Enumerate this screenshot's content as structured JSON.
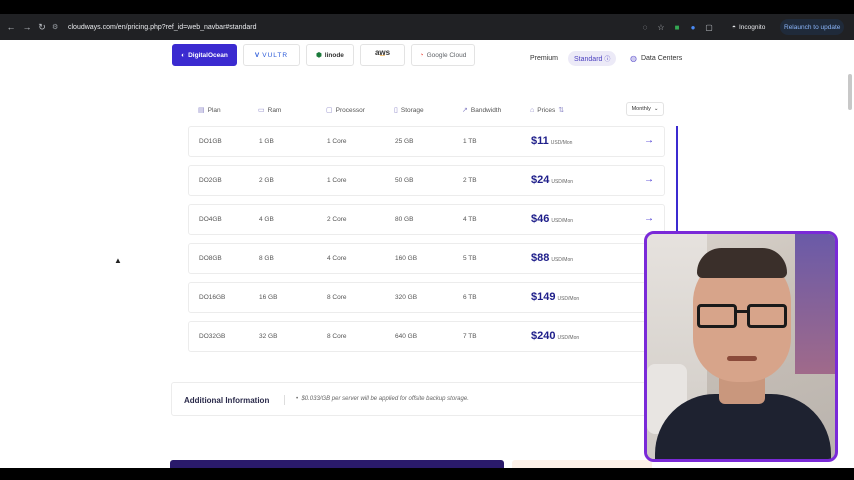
{
  "browser": {
    "url": "cloudways.com/en/pricing.php?ref_id=web_navbar#standard",
    "incognito_label": "Incognito",
    "relaunch_label": "Relaunch to update"
  },
  "providers": [
    {
      "label": "DigitalOcean",
      "logo": "◐",
      "active": true
    },
    {
      "label": "VULTR",
      "logo": "V",
      "active": false
    },
    {
      "label": "linode",
      "logo": "⬢",
      "active": false
    },
    {
      "label": "aws",
      "logo": "",
      "active": false
    },
    {
      "label": "Google Cloud",
      "logo": "◔",
      "active": false
    }
  ],
  "plan_toggle": {
    "premium": "Premium",
    "standard": "Standard"
  },
  "data_centers_label": "Data Centers",
  "table": {
    "headers": {
      "plan": "Plan",
      "ram": "Ram",
      "processor": "Processor",
      "storage": "Storage",
      "bandwidth": "Bandwidth",
      "prices": "Prices"
    },
    "billing_select": "Monthly",
    "price_unit": "USD/Mon",
    "rows": [
      {
        "plan": "DO1GB",
        "ram": "1 GB",
        "processor": "1 Core",
        "storage": "25 GB",
        "bandwidth": "1 TB",
        "price": "$11"
      },
      {
        "plan": "DO2GB",
        "ram": "2 GB",
        "processor": "1 Core",
        "storage": "50 GB",
        "bandwidth": "2 TB",
        "price": "$24"
      },
      {
        "plan": "DO4GB",
        "ram": "4 GB",
        "processor": "2 Core",
        "storage": "80 GB",
        "bandwidth": "4 TB",
        "price": "$46"
      },
      {
        "plan": "DO8GB",
        "ram": "8 GB",
        "processor": "4 Core",
        "storage": "160 GB",
        "bandwidth": "5 TB",
        "price": "$88"
      },
      {
        "plan": "DO16GB",
        "ram": "16 GB",
        "processor": "8 Core",
        "storage": "320 GB",
        "bandwidth": "6 TB",
        "price": "$149"
      },
      {
        "plan": "DO32GB",
        "ram": "32 GB",
        "processor": "8 Core",
        "storage": "640 GB",
        "bandwidth": "7 TB",
        "price": "$240"
      }
    ]
  },
  "additional_info": {
    "title": "Additional Information",
    "note": "$0.033/GB per server will be applied for offsite backup storage."
  },
  "colors": {
    "accent": "#3b2ad0",
    "price": "#1e1e8a",
    "webcam_border": "#7a2ad8"
  }
}
